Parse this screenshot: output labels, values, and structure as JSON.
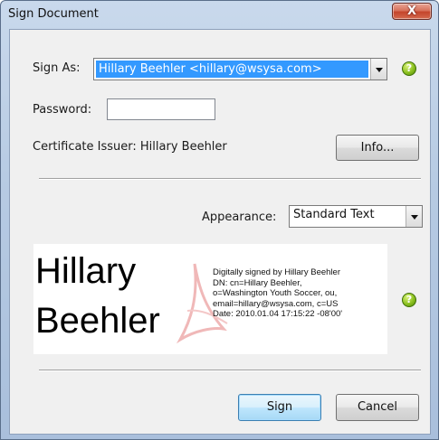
{
  "dialog": {
    "title": "Sign Document",
    "close_glyph": "X"
  },
  "sign_as": {
    "label": "Sign As:",
    "selected": "Hillary Beehler <hillary@wsysa.com>"
  },
  "password": {
    "label": "Password:",
    "value": ""
  },
  "certificate": {
    "issuer_text": "Certificate Issuer: Hillary Beehler",
    "info_button": "Info..."
  },
  "appearance": {
    "label": "Appearance:",
    "selected": "Standard Text"
  },
  "preview": {
    "name_line1": "Hillary",
    "name_line2": "Beehler",
    "details": [
      "Digitally signed by Hillary Beehler",
      "DN: cn=Hillary Beehler,",
      "o=Washington Youth Soccer, ou,",
      "email=hillary@wsysa.com, c=US",
      "Date: 2010.01.04 17:15:22 -08'00'"
    ]
  },
  "buttons": {
    "sign": "Sign",
    "cancel": "Cancel"
  },
  "help_glyph": "?",
  "icons": {
    "help": "help-icon",
    "close": "close-icon",
    "dropdown": "chevron-down-icon",
    "logo": "adobe-logo-watermark"
  },
  "colors": {
    "selection": "#3399ff",
    "help_green": "#8cc020",
    "close_red": "#c4452c",
    "window_frame": "#b7cbe3"
  }
}
